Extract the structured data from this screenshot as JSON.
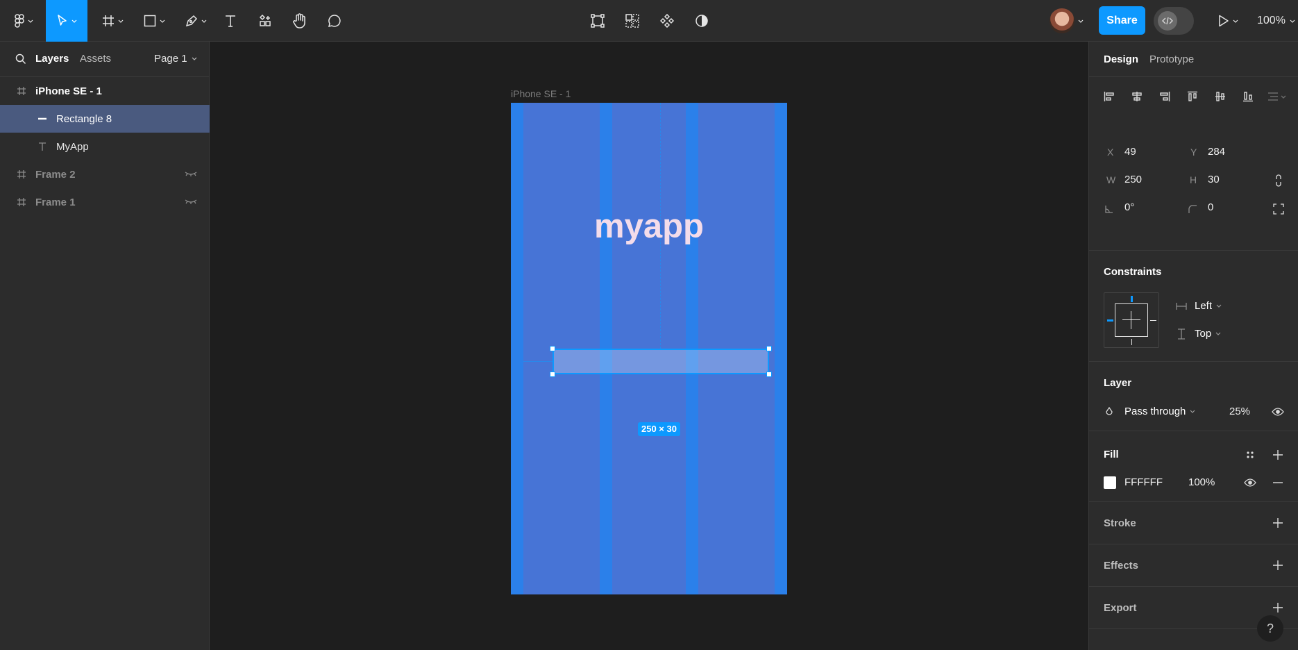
{
  "toolbar": {
    "share_label": "Share",
    "zoom": "100%"
  },
  "left_panel": {
    "tabs": {
      "layers": "Layers",
      "assets": "Assets"
    },
    "page_selector": "Page 1",
    "layers": [
      {
        "name": "iPhone SE - 1",
        "type": "frame",
        "bold": true
      },
      {
        "name": "Rectangle 8",
        "type": "rectangle",
        "selected": true
      },
      {
        "name": "MyApp",
        "type": "text"
      },
      {
        "name": "Frame 2",
        "type": "frame",
        "hidden": true
      },
      {
        "name": "Frame 1",
        "type": "frame",
        "hidden": true
      }
    ]
  },
  "canvas": {
    "frame_label": "iPhone SE - 1",
    "app_title": "myapp",
    "size_badge": "250 × 30",
    "frame_color": "#4774d6",
    "column_color": "#2b80ea",
    "selection_color": "#0d99ff"
  },
  "right_panel": {
    "tabs": {
      "design": "Design",
      "prototype": "Prototype"
    },
    "position": {
      "x_label": "X",
      "x": "49",
      "y_label": "Y",
      "y": "284",
      "w_label": "W",
      "w": "250",
      "h_label": "H",
      "h": "30",
      "rotation": "0°",
      "radius": "0"
    },
    "constraints": {
      "title": "Constraints",
      "horizontal": "Left",
      "vertical": "Top"
    },
    "layer": {
      "title": "Layer",
      "blend": "Pass through",
      "opacity": "25%"
    },
    "fill": {
      "title": "Fill",
      "hex": "FFFFFF",
      "opacity": "100%",
      "swatch_color": "#ffffff"
    },
    "stroke": {
      "title": "Stroke"
    },
    "effects": {
      "title": "Effects"
    },
    "export": {
      "title": "Export"
    },
    "help": "?"
  }
}
